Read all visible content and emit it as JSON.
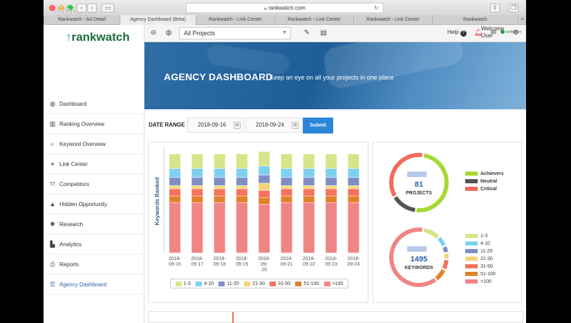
{
  "browser": {
    "url": "rankwatch.com",
    "watermark": "Google",
    "tabs": [
      {
        "label": "Rankwatch - Ad Detail"
      },
      {
        "label": "Agency Dashboard (Beta)",
        "active": true
      },
      {
        "label": "Rankwatch - Link Center"
      },
      {
        "label": "Rankwatch - Link Center"
      },
      {
        "label": "Rankwatch - Link Center"
      },
      {
        "label": "Rankwatch"
      }
    ],
    "new_tab": "+"
  },
  "sidebar": {
    "logo": "rankwatch",
    "items": [
      {
        "label": "Dashboard",
        "icon": "globe-icon"
      },
      {
        "label": "Ranking Overview",
        "icon": "bar-chart-icon"
      },
      {
        "label": "Keyword Overview",
        "icon": "search-icon"
      },
      {
        "label": "Link Center",
        "icon": "link-icon"
      },
      {
        "label": "Competitors",
        "icon": "arrows-icon"
      },
      {
        "label": "Hidden Opportunity",
        "icon": "hat-icon"
      },
      {
        "label": "Research",
        "icon": "gear-icon"
      },
      {
        "label": "Analytics",
        "icon": "analytics-icon"
      },
      {
        "label": "Reports",
        "icon": "pdf-icon"
      },
      {
        "label": "Agency Dashboard",
        "icon": "list-icon",
        "active": true
      }
    ]
  },
  "topbar": {
    "project_select": "All Projects",
    "help": "Help",
    "brand_badge": "rankwatch",
    "welcome": "Welcome",
    "user": "User"
  },
  "hero": {
    "title": "AGENCY DASHBOARD",
    "subtitle": "Keep an eye on all your projects in one place"
  },
  "date_range": {
    "label": "DATE RANGE",
    "from": "2018-09-16",
    "to": "2018-09-24",
    "submit": "Submit"
  },
  "colors": {
    "r1_3": "#d7e48a",
    "r4_10": "#7fd0ee",
    "r11_20": "#7f8fc6",
    "r21_30": "#f5d57a",
    "r31_50": "#f5735c",
    "r51_100": "#e0812b",
    "r100": "#f08585",
    "achievers": "#a6d934",
    "neutral": "#555555",
    "critical": "#f26b5b"
  },
  "chart_data": [
    {
      "type": "bar",
      "ylabel": "Keywords Ranked",
      "categories": [
        "2018-09-16",
        "2018-09-17",
        "2018-09-18",
        "2018-09-19",
        "2018-09-20",
        "2018-09-21",
        "2018-09-22",
        "2018-09-23",
        "2018-09-24"
      ],
      "series": [
        {
          "name": "1-3",
          "color": "#d7e48a",
          "values": [
            18,
            18,
            18,
            18,
            18,
            18,
            18,
            18,
            18
          ]
        },
        {
          "name": "4-10",
          "color": "#7fd0ee",
          "values": [
            11,
            11,
            11,
            11,
            11,
            11,
            11,
            11,
            11
          ]
        },
        {
          "name": "11-20",
          "color": "#7f8fc6",
          "values": [
            10,
            10,
            10,
            10,
            10,
            10,
            10,
            10,
            10
          ]
        },
        {
          "name": "21-30",
          "color": "#f5d57a",
          "values": [
            4,
            4,
            4,
            4,
            9,
            4,
            4,
            4,
            4
          ]
        },
        {
          "name": "31-50",
          "color": "#f5735c",
          "values": [
            9,
            9,
            9,
            9,
            9,
            9,
            9,
            9,
            9
          ]
        },
        {
          "name": "51-100",
          "color": "#e0812b",
          "values": [
            8,
            8,
            8,
            8,
            8,
            8,
            8,
            8,
            8
          ]
        },
        {
          "name": ">100",
          "color": "#f08585",
          "values": [
            62,
            62,
            62,
            62,
            60,
            62,
            62,
            62,
            62
          ]
        }
      ]
    },
    {
      "type": "pie",
      "title": "PROJECTS",
      "total": "81",
      "legend": [
        "Achievers",
        "Neutral",
        "Critical"
      ],
      "values": [
        40,
        12,
        29
      ],
      "colors": [
        "#a6d934",
        "#555555",
        "#f26b5b"
      ]
    },
    {
      "type": "pie",
      "title": "KEYWORDS",
      "total": "1495",
      "legend": [
        "1-3",
        "4-10",
        "11-20",
        "21-30",
        "31-50",
        "51-100",
        ">100"
      ],
      "values": [
        150,
        90,
        60,
        55,
        90,
        110,
        940
      ],
      "colors": [
        "#d7e48a",
        "#7fd0ee",
        "#7f8fc6",
        "#f5d57a",
        "#f5735c",
        "#e0812b",
        "#f08585"
      ]
    }
  ]
}
